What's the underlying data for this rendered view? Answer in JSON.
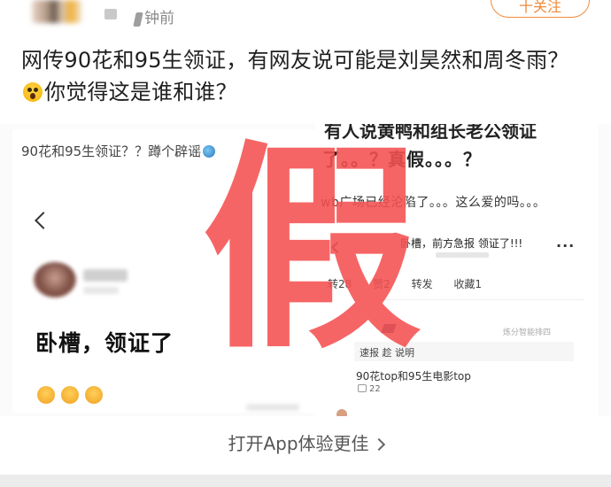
{
  "header": {
    "time_text": "钟前",
    "follow_label": "十关注"
  },
  "post": {
    "text_part1": "网传90花和95生领证，有网友说可能是刘昊然和周冬雨？",
    "text_part2": "你觉得这是谁和谁？"
  },
  "left_screenshot": {
    "caption": "90花和95生领证？？蹲个辟谣",
    "message": "卧槽，领证了"
  },
  "right_screenshot": {
    "line1": "有人说黄鸭和组长老公领证",
    "line2": "了。。？真假。。。？",
    "line3": "wb广场已经沦陷了。。。这么爱的吗。。。",
    "title": "卧槽，前方急报 领证了!!!",
    "more": "···",
    "tabs": [
      "转28",
      "赞2",
      "转发",
      "收藏1"
    ],
    "gray_label": "炼分智能排四",
    "row_text": "速报 趁 说明",
    "comment": "90花top和95生电影top",
    "likes": "22"
  },
  "stamp_text": "假",
  "open_app_label": "打开App体验更佳"
}
